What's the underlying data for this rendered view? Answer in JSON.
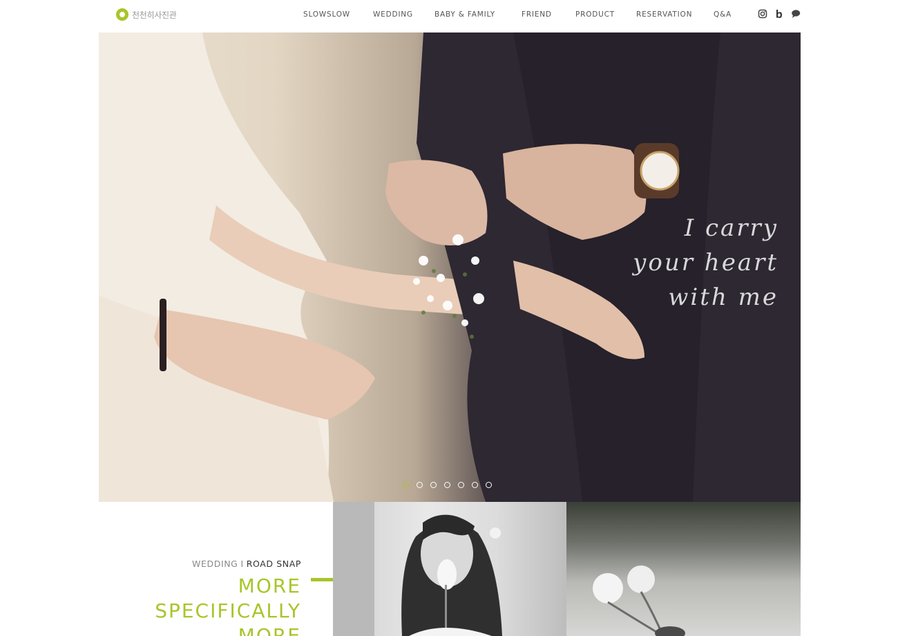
{
  "header": {
    "logo_text": "천천히사진관",
    "nav": [
      {
        "label": "SLOWSLOW"
      },
      {
        "label": "WEDDING"
      },
      {
        "label": "BABY & FAMILY"
      },
      {
        "label": "FRIEND"
      },
      {
        "label": "PRODUCT"
      },
      {
        "label": "RESERVATION"
      },
      {
        "label": "Q&A"
      }
    ],
    "social_icons": [
      "instagram-icon",
      "blog-icon",
      "chat-icon"
    ]
  },
  "hero": {
    "quote_lines": [
      "I carry",
      "your heart",
      "with me"
    ],
    "slide_count": 7,
    "active_slide": 1
  },
  "promo": {
    "category_primary": "WEDDING",
    "separator": "I",
    "category_secondary": "ROAD SNAP",
    "title_lines": [
      "MORE",
      "SPECIFICALLY",
      "MORE"
    ]
  },
  "colors": {
    "accent": "#a8c52a",
    "nav_text": "#555555"
  }
}
